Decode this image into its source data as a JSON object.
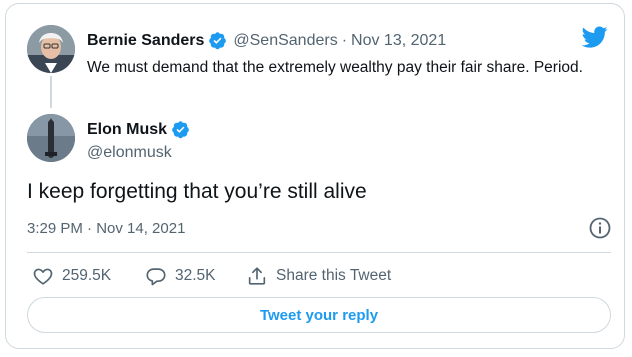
{
  "parent": {
    "display_name": "Bernie Sanders",
    "handle": "@SenSanders",
    "separator": "·",
    "date": "Nov 13, 2021",
    "text": "We must demand that the extremely wealthy pay their fair share. Period."
  },
  "reply": {
    "display_name": "Elon Musk",
    "handle": "@elonmusk",
    "text": "I keep forgetting that you’re still alive",
    "timestamp": "3:29 PM · Nov 14, 2021"
  },
  "actions": {
    "likes": "259.5K",
    "replies": "32.5K",
    "share_label": "Share this Tweet"
  },
  "reply_button_label": "Tweet your reply",
  "colors": {
    "accent": "#1d9bf0",
    "text": "#0f1419",
    "muted": "#536471",
    "border": "#cfd9de"
  },
  "icons": [
    "twitter-bird-icon",
    "verified-badge-icon",
    "info-icon",
    "like-heart-icon",
    "reply-bubble-icon",
    "share-icon"
  ]
}
